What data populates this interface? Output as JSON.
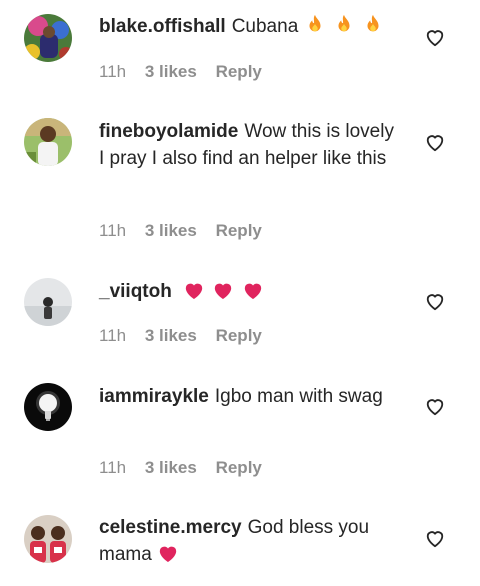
{
  "comments": [
    {
      "username": "blake.offishall",
      "text": "Cubana",
      "emoji": [
        "fire-icon",
        "fire-icon",
        "fire-icon"
      ],
      "time": "11h",
      "likes": "3 likes",
      "reply": "Reply"
    },
    {
      "username": "fineboyolamide",
      "text": "Wow this is lovely I pray I also find an helper like this",
      "emoji": [],
      "time": "11h",
      "likes": "3 likes",
      "reply": "Reply"
    },
    {
      "username": "_viiqtoh",
      "text": "",
      "emoji": [
        "red-heart-icon",
        "red-heart-icon",
        "red-heart-icon"
      ],
      "time": "11h",
      "likes": "3 likes",
      "reply": "Reply"
    },
    {
      "username": "iammiraykle",
      "text": "Igbo man with swag",
      "emoji": [],
      "time": "11h",
      "likes": "3 likes",
      "reply": "Reply"
    },
    {
      "username": "celestine.mercy",
      "text": "God bless you mama",
      "emoji": [
        "red-heart-icon"
      ],
      "time": "",
      "likes": "",
      "reply": ""
    }
  ],
  "colors": {
    "text": "#262626",
    "meta": "#8e8e8e",
    "heart_emoji": "#e0245e",
    "fire": "#f7931e"
  }
}
